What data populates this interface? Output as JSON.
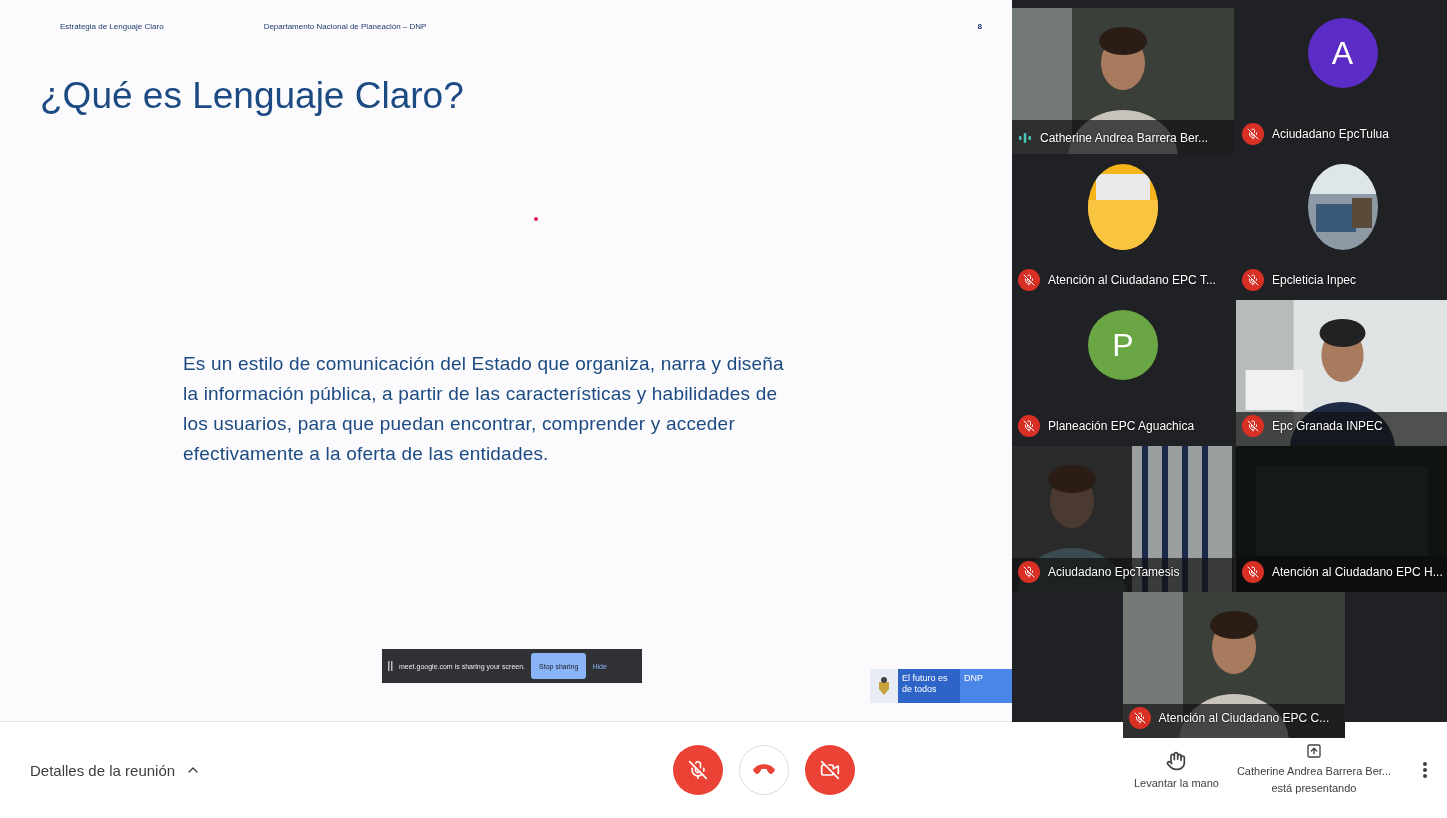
{
  "slide": {
    "header_left": "Estrategia de Lenguaje Claro",
    "header_center": "Departamento Nacional de Planeación – DNP",
    "page_number": "8",
    "title": "¿Qué es Lenguaje Claro?",
    "body": "Es un estilo de comunicación del Estado que organiza, narra y diseña la información pública, a partir de las características y habilidades de los usuarios, para que puedan encontrar, comprender y acceder efectivamente a la oferta de las entidades.",
    "logo": {
      "slogan": "El futuro es de todos",
      "entity": "DNP"
    }
  },
  "share_bar": {
    "message": "meet.google.com is sharing your screen.",
    "stop_button": "Stop sharing",
    "hide_link": "Hide"
  },
  "participants": [
    {
      "name": "Catherine Andrea Barrera Ber...",
      "kind": "video",
      "muted": false
    },
    {
      "name": "Aciudadano EpcTulua",
      "kind": "letter",
      "initial": "A",
      "color": "#5b2cc6",
      "muted": true
    },
    {
      "name": "Atención al Ciudadano EPC T...",
      "kind": "picture-avatar",
      "muted": true
    },
    {
      "name": "Epcleticia Inpec",
      "kind": "picture-avatar",
      "muted": true
    },
    {
      "name": "Planeación EPC Aguachica",
      "kind": "letter",
      "initial": "P",
      "color": "#6aa744",
      "muted": true
    },
    {
      "name": "Epc Granada INPEC",
      "kind": "video",
      "muted": true
    },
    {
      "name": "Aciudadano EpcTamesis",
      "kind": "video",
      "muted": true
    },
    {
      "name": "Atención al Ciudadano EPC H...",
      "kind": "dark",
      "muted": true
    },
    {
      "name": "Atención al Ciudadano EPC C...",
      "kind": "video",
      "muted": true
    }
  ],
  "bottom_bar": {
    "meeting_details": "Detalles de la reunión",
    "controls": [
      {
        "kind": "mic",
        "off": true
      },
      {
        "kind": "hangup"
      },
      {
        "kind": "camera",
        "off": true
      }
    ],
    "raise_hand": "Levantar la mano",
    "presenter": "Catherine Andrea Barrera Ber...",
    "presenter_status": "está presentando"
  }
}
